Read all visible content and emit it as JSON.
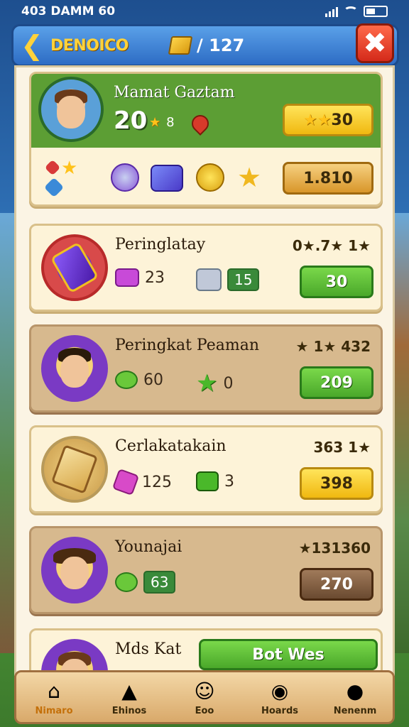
{
  "status_bar": {
    "time": "403 DAMM  60"
  },
  "header": {
    "title": "DENOICO",
    "currency_value": "/ 127"
  },
  "top_card": {
    "name": "Mamat Gaztam",
    "level": "20",
    "stars": "8",
    "primary_button": "30",
    "secondary_button": "1.810"
  },
  "rows": [
    {
      "name": "Peringlatay",
      "score": "0★.7★ 1★",
      "stat1": "23",
      "stat2": "15",
      "button": "30"
    },
    {
      "name": "Peringkat Peaman",
      "score": "★ 1★ 432",
      "stat1": "60",
      "stat2": "0",
      "button": "209"
    },
    {
      "name": "Cerlakatakain",
      "score": "363 1★",
      "stat1": "125",
      "stat2": "3",
      "button": "398"
    },
    {
      "name": "Younajai",
      "score": "★131360",
      "stat1": "63",
      "button": "270"
    }
  ],
  "partial_row": {
    "name": "Mds Kat",
    "button": "Bot Wes"
  },
  "nav": [
    {
      "label": "Nimaro",
      "icon": "home-icon"
    },
    {
      "label": "Ehinos",
      "icon": "shop-icon"
    },
    {
      "label": "Eoo",
      "icon": "face-icon"
    },
    {
      "label": "Hoards",
      "icon": "target-icon"
    },
    {
      "label": "Nenenm",
      "icon": "friends-icon"
    }
  ]
}
